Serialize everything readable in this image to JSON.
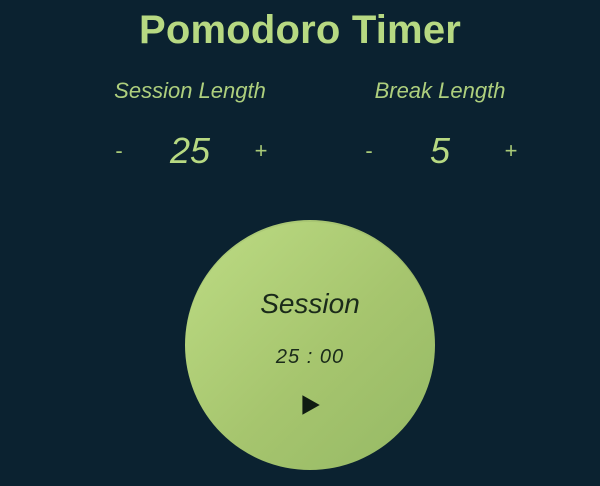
{
  "app": {
    "title": "Pomodoro Timer"
  },
  "session": {
    "label": "Session Length",
    "decrement_label": "-",
    "increment_label": "+",
    "value": "25"
  },
  "break": {
    "label": "Break Length",
    "decrement_label": "-",
    "increment_label": "+",
    "value": "5"
  },
  "timer": {
    "mode_label": "Session",
    "time": "25 : 00",
    "play_icon": "play-icon"
  },
  "colors": {
    "background": "#0b2230",
    "accent": "#b7d982",
    "timer_fill": "#a6c56e",
    "timer_text": "#1a2a1a"
  }
}
